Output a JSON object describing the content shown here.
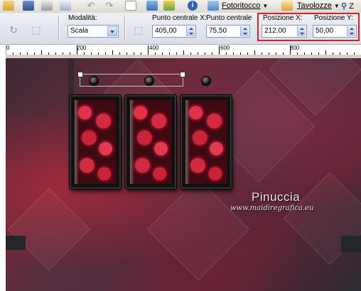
{
  "menu": {
    "fotoritocco": "Fotoritocco",
    "tavolozze": "Tavolozze",
    "zoom_partial": "Z"
  },
  "options": {
    "mode_label": "Modalità:",
    "mode_value": "Scala",
    "center_x_label": "Punto centrale X:",
    "center_x_value": "405,00",
    "center_y_label": "Punto centrale Y:",
    "center_y_value": "75,50",
    "pos_x_label": "Posizione X:",
    "pos_x_value": "212,00",
    "pos_y_label": "Posizione Y:",
    "pos_y_value": "50,00"
  },
  "ruler": {
    "labels": [
      "0",
      "200",
      "400",
      "600",
      "800"
    ]
  },
  "canvas": {
    "watermark_name": "Pinuccia",
    "watermark_url": "www.maidiregrafica.eu"
  },
  "colors": {
    "highlight": "#d0202c",
    "accent": "#2a4b8d"
  },
  "icons": [
    "save-icon",
    "print-icon",
    "undo-icon",
    "redo-icon",
    "info-icon",
    "search-icon",
    "rotate-icon",
    "crop-icon",
    "move-icon"
  ]
}
